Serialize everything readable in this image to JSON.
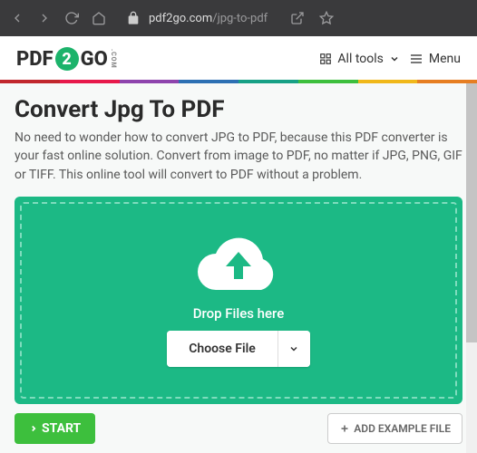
{
  "browser": {
    "url_host": "pdf2go.com",
    "url_path": "/jpg-to-pdf"
  },
  "logo": {
    "p1": "PDF",
    "mid": "2",
    "p2": "GO",
    "suffix": ".COM"
  },
  "header": {
    "alltools": "All tools",
    "menu": "Menu"
  },
  "color_strip": [
    "#c1272d",
    "#e7194b",
    "#8e44ad",
    "#2d70b3",
    "#17a085",
    "#3dbf3d",
    "#f0b81a",
    "#e67e22"
  ],
  "main": {
    "title": "Convert Jpg To PDF",
    "subtitle": "No need to wonder how to convert JPG to PDF, because this PDF converter is your fast online solution. Convert from image to PDF, no matter if JPG, PNG, GIF or TIFF. This online tool will convert to PDF without a problem."
  },
  "dropzone": {
    "drop_text": "Drop Files here",
    "choose_label": "Choose File"
  },
  "actions": {
    "start": "START",
    "example": "ADD EXAMPLE FILE"
  }
}
